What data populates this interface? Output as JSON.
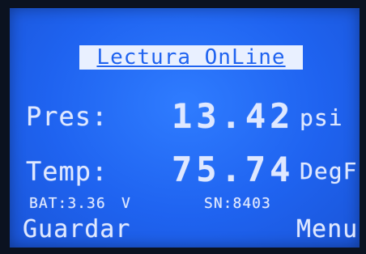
{
  "screen": {
    "title": "Lectura OnLine",
    "pressure": {
      "label": "Pres:",
      "value": "13.42",
      "unit": "psi"
    },
    "temperature": {
      "label": "Temp:",
      "value": "75.74",
      "unit": "DegF"
    },
    "status": {
      "battery": "BAT:3.36",
      "battery_unit": "V",
      "serial": "SN:8403"
    },
    "softkeys": {
      "left": "Guardar",
      "right": "Menu"
    }
  },
  "colors": {
    "lcd_background": "#1f63f0",
    "lcd_text": "#dfe8ff"
  }
}
